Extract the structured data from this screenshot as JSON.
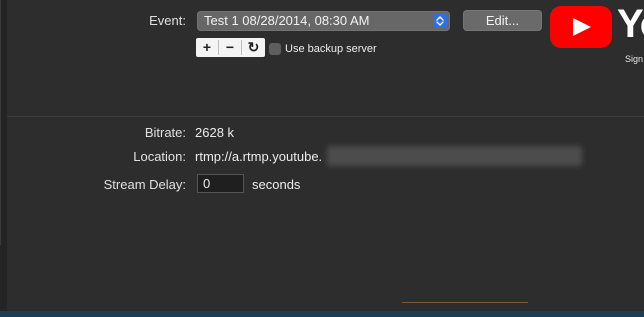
{
  "event": {
    "label": "Event:",
    "selected": "Test 1   08/28/2014, 08:30 AM",
    "edit_button": "Edit..."
  },
  "controls": {
    "add": "+",
    "remove": "−",
    "refresh": "↻",
    "backup_label": "Use backup server"
  },
  "info": {
    "bitrate_label": "Bitrate:",
    "bitrate_value": "2628 k",
    "location_label": "Location:",
    "location_value": "rtmp://a.rtmp.youtube."
  },
  "delay": {
    "label": "Stream Delay:",
    "value": "0",
    "unit": "seconds"
  },
  "youtube": {
    "word": "Yo",
    "sign": "Sign"
  },
  "colors": {
    "background": "#2d2d2d",
    "accent_blue": "#2f6fe0",
    "youtube_red": "#ff0000"
  },
  "icons": [
    "chevron-updown-icon",
    "play-icon",
    "plus-icon",
    "minus-icon",
    "refresh-icon"
  ]
}
